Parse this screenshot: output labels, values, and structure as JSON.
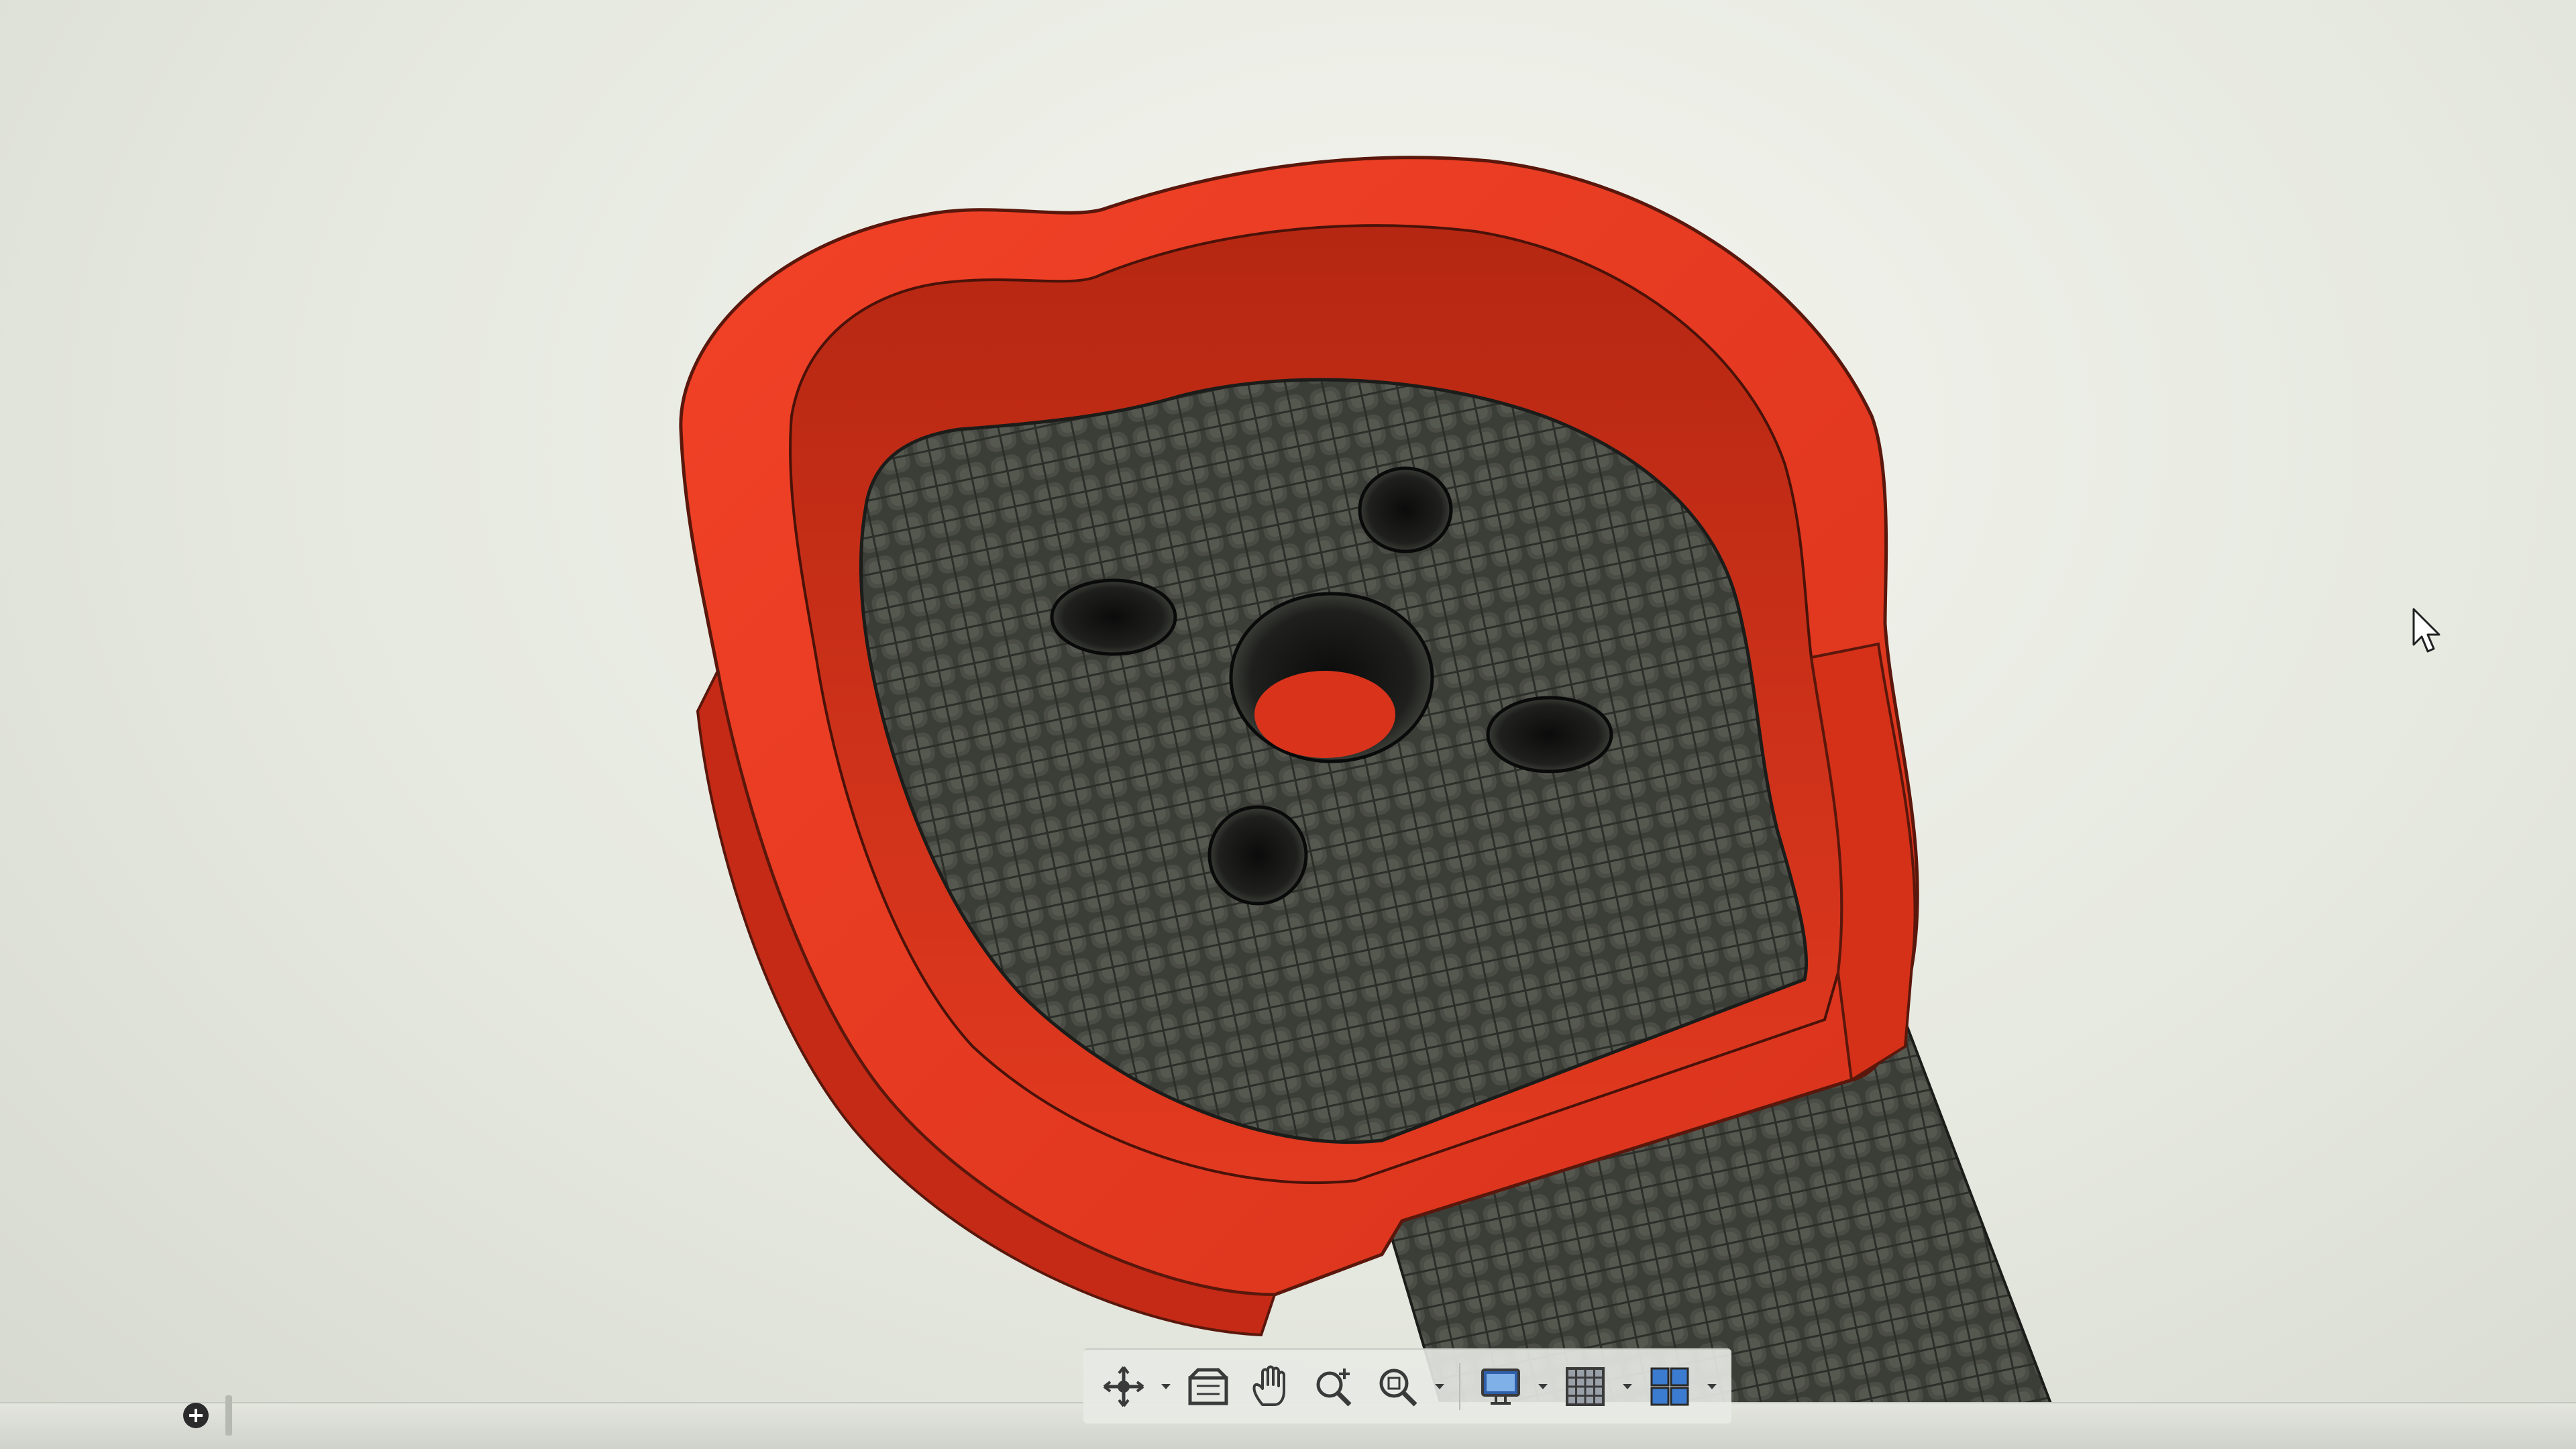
{
  "app": {
    "window": "3d-modeling-viewport"
  },
  "model": {
    "body_color": "#ee3a22",
    "body_shadow_color": "#c42a16",
    "plate_color": "#3b3d37",
    "plate_grid_color": "#66695f",
    "hole_color": "#141414"
  },
  "toolbar": {
    "items": [
      {
        "name": "orbit",
        "icon": "orbit-icon",
        "has_dropdown": true
      },
      {
        "name": "look-at",
        "icon": "look-at-icon",
        "has_dropdown": false
      },
      {
        "name": "pan",
        "icon": "hand-pan-icon",
        "has_dropdown": false
      },
      {
        "name": "zoom",
        "icon": "zoom-icon",
        "has_dropdown": false
      },
      {
        "name": "fit",
        "icon": "zoom-window-icon",
        "has_dropdown": true
      },
      {
        "name": "display-settings",
        "icon": "monitor-icon",
        "has_dropdown": true
      },
      {
        "name": "grid-and-snaps",
        "icon": "grid-icon",
        "has_dropdown": true
      },
      {
        "name": "viewports",
        "icon": "viewports-icon",
        "has_dropdown": true
      }
    ]
  },
  "status": {
    "add_icon": "plus-circle-icon"
  }
}
